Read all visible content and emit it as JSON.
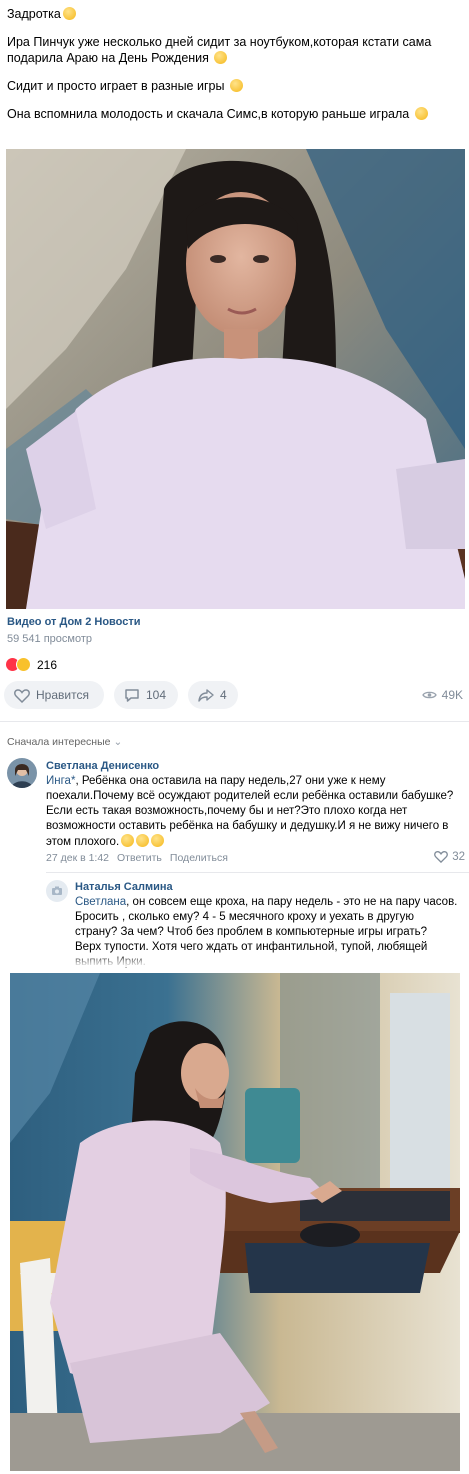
{
  "post": {
    "line1": "Задротка",
    "line2a": "Ира Пинчук уже несколько дней сидит за ноутбуком,которая кстати сама",
    "line2b": "подарила Араю на День Рождения",
    "line3": "Сидит и просто играет в разные игры",
    "line4": "Она вспомнила молодость и скачала Симс,в которую раньше играла"
  },
  "video": {
    "caption": "Видео от Дом 2 Новости",
    "views": "59 541 просмотр"
  },
  "reactions": {
    "count": "216"
  },
  "actions": {
    "like_label": "Нравится",
    "comments_count": "104",
    "shares_count": "4",
    "views_count": "49K"
  },
  "comments_sort": "Сначала интересные",
  "comments": [
    {
      "author": "Светлана Денисенко",
      "mention": "Инга*",
      "lines": [
        ", Ребёнка она оставила на пару недель,27 они уже к нему",
        "поехали.Почему всё осуждают родителей если ребёнка оставили бабушке?",
        "Если есть такая возможность,почему бы и нет?Это плохо когда нет",
        "возможности оставить ребёнка на бабушку и дедушку.И я не вижу ничего в",
        "этом плохого."
      ],
      "date": "27 дек в 1:42",
      "reply_label": "Ответить",
      "share_label": "Поделиться",
      "likes": "32"
    },
    {
      "author": "Наталья Салмина",
      "mention": "Светлана",
      "lines": [
        ", он совсем еще кроха, на пару недель - это не на пару часов.",
        "Бросить , сколько ему? 4 - 5 месячного кроху и уехать в другую",
        "страну? За чем? Чтоб без проблем в компьютерные игры играть?",
        "Верх тупости. Хотя чего ждать от инфантильной, тупой, любящей",
        "выпить  Ирки."
      ]
    }
  ],
  "icons": {
    "like": "heart-outline-icon",
    "comment": "comment-bubble-icon",
    "share": "share-arrow-icon",
    "views": "eye-icon"
  },
  "colors": {
    "link": "#2a5885",
    "muted": "#818c99",
    "pill_bg": "#f0f2f5"
  }
}
